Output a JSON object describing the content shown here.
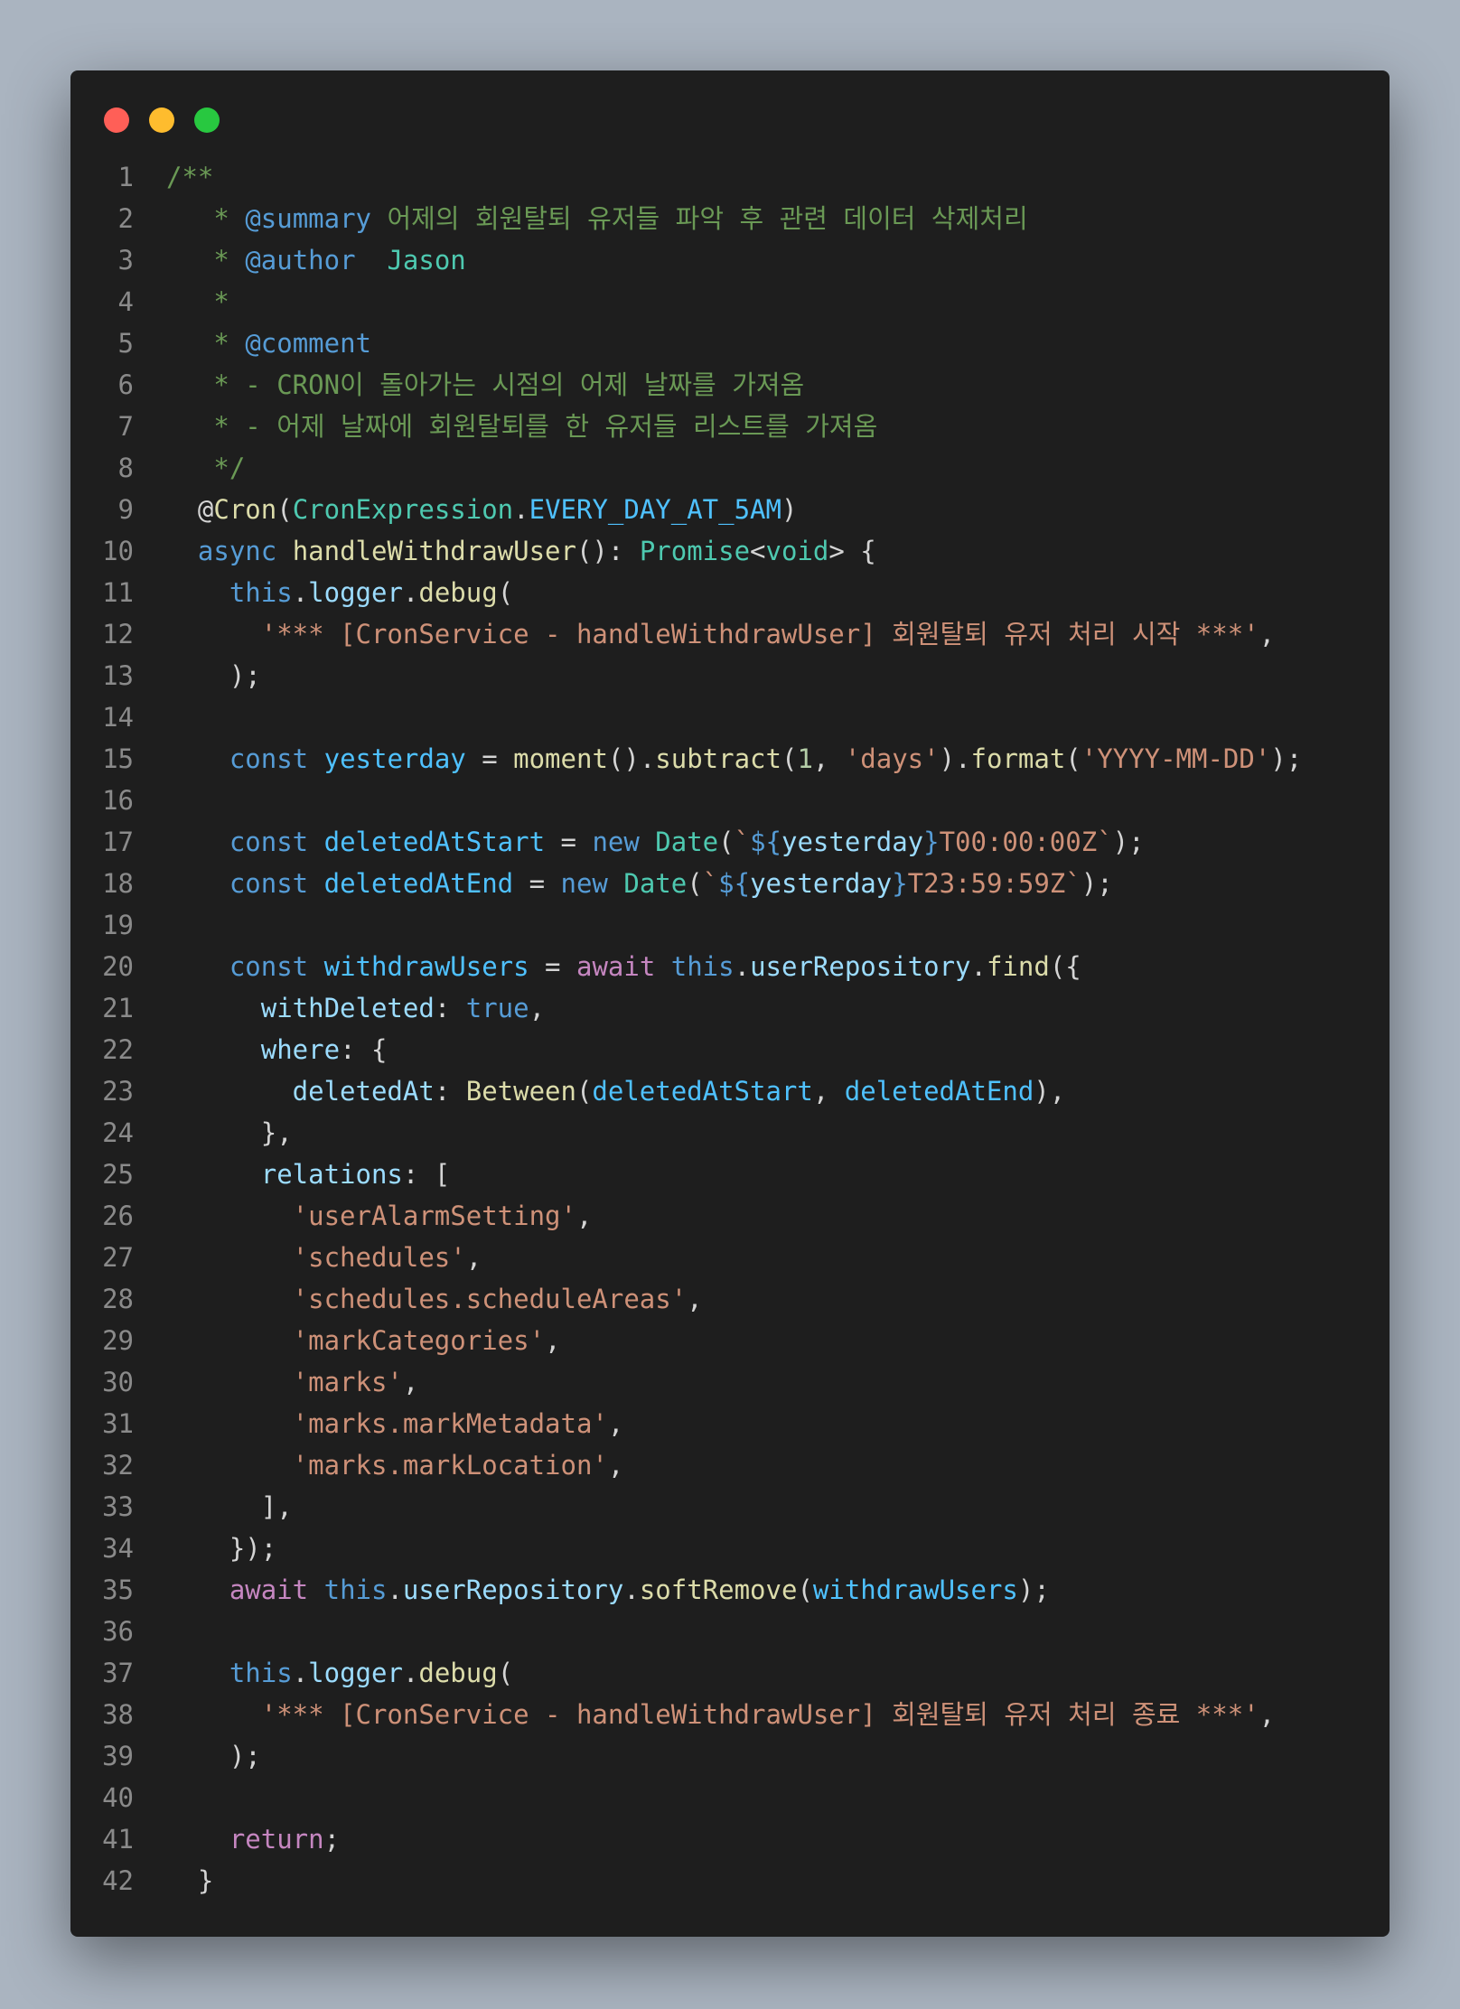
{
  "window": {
    "controls": {
      "close": "close",
      "minimize": "minimize",
      "zoom": "zoom"
    },
    "colors": {
      "close": "#ff5f57",
      "minimize": "#febc2e",
      "zoom": "#28c840",
      "background": "#1e1e1e"
    }
  },
  "code": {
    "language": "typescript",
    "lines": [
      {
        "n": "1",
        "t": [
          [
            "cm",
            "/**"
          ]
        ]
      },
      {
        "n": "2",
        "t": [
          [
            "cm",
            "   * "
          ],
          [
            "cmtag",
            "@summary"
          ],
          [
            "cm",
            " 어제의 회원탈퇴 유저들 파악 후 관련 데이터 삭제처리"
          ]
        ]
      },
      {
        "n": "3",
        "t": [
          [
            "cm",
            "   * "
          ],
          [
            "cmtag",
            "@author"
          ],
          [
            "cm",
            "  "
          ],
          [
            "ty",
            "Jason"
          ]
        ]
      },
      {
        "n": "4",
        "t": [
          [
            "cm",
            "   *"
          ]
        ]
      },
      {
        "n": "5",
        "t": [
          [
            "cm",
            "   * "
          ],
          [
            "cmtag",
            "@comment"
          ]
        ]
      },
      {
        "n": "6",
        "t": [
          [
            "cm",
            "   * - CRON이 돌아가는 시점의 어제 날짜를 가져옴"
          ]
        ]
      },
      {
        "n": "7",
        "t": [
          [
            "cm",
            "   * - 어제 날짜에 회원탈퇴를 한 유저들 리스트를 가져옴"
          ]
        ]
      },
      {
        "n": "8",
        "t": [
          [
            "cm",
            "   */"
          ]
        ]
      },
      {
        "n": "9",
        "t": [
          [
            "pn",
            "  @"
          ],
          [
            "fn",
            "Cron"
          ],
          [
            "pn",
            "("
          ],
          [
            "ty",
            "CronExpression"
          ],
          [
            "pn",
            "."
          ],
          [
            "cst",
            "EVERY_DAY_AT_5AM"
          ],
          [
            "pn",
            ")"
          ]
        ]
      },
      {
        "n": "10",
        "t": [
          [
            "kw",
            "  async "
          ],
          [
            "fn",
            "handleWithdrawUser"
          ],
          [
            "pn",
            "(): "
          ],
          [
            "ty",
            "Promise"
          ],
          [
            "pn",
            "<"
          ],
          [
            "ty",
            "void"
          ],
          [
            "pn",
            "> {"
          ]
        ]
      },
      {
        "n": "11",
        "t": [
          [
            "kw",
            "    this"
          ],
          [
            "pn",
            "."
          ],
          [
            "var",
            "logger"
          ],
          [
            "pn",
            "."
          ],
          [
            "fn",
            "debug"
          ],
          [
            "pn",
            "("
          ]
        ]
      },
      {
        "n": "12",
        "t": [
          [
            "str",
            "      '*** [CronService - handleWithdrawUser] 회원탈퇴 유저 처리 시작 ***'"
          ],
          [
            "pn",
            ","
          ]
        ]
      },
      {
        "n": "13",
        "t": [
          [
            "pn",
            "    );"
          ]
        ]
      },
      {
        "n": "14",
        "t": []
      },
      {
        "n": "15",
        "t": [
          [
            "kw",
            "    const "
          ],
          [
            "cst",
            "yesterday"
          ],
          [
            "pn",
            " = "
          ],
          [
            "fn",
            "moment"
          ],
          [
            "pn",
            "()."
          ],
          [
            "fn",
            "subtract"
          ],
          [
            "pn",
            "("
          ],
          [
            "num",
            "1"
          ],
          [
            "pn",
            ", "
          ],
          [
            "str",
            "'days'"
          ],
          [
            "pn",
            ")."
          ],
          [
            "fn",
            "format"
          ],
          [
            "pn",
            "("
          ],
          [
            "str",
            "'YYYY-MM-DD'"
          ],
          [
            "pn",
            ");"
          ]
        ]
      },
      {
        "n": "16",
        "t": []
      },
      {
        "n": "17",
        "t": [
          [
            "kw",
            "    const "
          ],
          [
            "cst",
            "deletedAtStart"
          ],
          [
            "pn",
            " = "
          ],
          [
            "kw",
            "new "
          ],
          [
            "ty",
            "Date"
          ],
          [
            "pn",
            "("
          ],
          [
            "str",
            "`"
          ],
          [
            "kw",
            "${"
          ],
          [
            "var",
            "yesterday"
          ],
          [
            "kw",
            "}"
          ],
          [
            "str",
            "T00:00:00Z`"
          ],
          [
            "pn",
            ");"
          ]
        ]
      },
      {
        "n": "18",
        "t": [
          [
            "kw",
            "    const "
          ],
          [
            "cst",
            "deletedAtEnd"
          ],
          [
            "pn",
            " = "
          ],
          [
            "kw",
            "new "
          ],
          [
            "ty",
            "Date"
          ],
          [
            "pn",
            "("
          ],
          [
            "str",
            "`"
          ],
          [
            "kw",
            "${"
          ],
          [
            "var",
            "yesterday"
          ],
          [
            "kw",
            "}"
          ],
          [
            "str",
            "T23:59:59Z`"
          ],
          [
            "pn",
            ");"
          ]
        ]
      },
      {
        "n": "19",
        "t": []
      },
      {
        "n": "20",
        "t": [
          [
            "kw",
            "    const "
          ],
          [
            "cst",
            "withdrawUsers"
          ],
          [
            "pn",
            " = "
          ],
          [
            "ctl",
            "await "
          ],
          [
            "kw",
            "this"
          ],
          [
            "pn",
            "."
          ],
          [
            "var",
            "userRepository"
          ],
          [
            "pn",
            "."
          ],
          [
            "fn",
            "find"
          ],
          [
            "pn",
            "({"
          ]
        ]
      },
      {
        "n": "21",
        "t": [
          [
            "var",
            "      withDeleted"
          ],
          [
            "pn",
            ": "
          ],
          [
            "kw",
            "true"
          ],
          [
            "pn",
            ","
          ]
        ]
      },
      {
        "n": "22",
        "t": [
          [
            "var",
            "      where"
          ],
          [
            "pn",
            ": {"
          ]
        ]
      },
      {
        "n": "23",
        "t": [
          [
            "var",
            "        deletedAt"
          ],
          [
            "pn",
            ": "
          ],
          [
            "fn",
            "Between"
          ],
          [
            "pn",
            "("
          ],
          [
            "cst",
            "deletedAtStart"
          ],
          [
            "pn",
            ", "
          ],
          [
            "cst",
            "deletedAtEnd"
          ],
          [
            "pn",
            "),"
          ]
        ]
      },
      {
        "n": "24",
        "t": [
          [
            "pn",
            "      },"
          ]
        ]
      },
      {
        "n": "25",
        "t": [
          [
            "var",
            "      relations"
          ],
          [
            "pn",
            ": ["
          ]
        ]
      },
      {
        "n": "26",
        "t": [
          [
            "str",
            "        'userAlarmSetting'"
          ],
          [
            "pn",
            ","
          ]
        ]
      },
      {
        "n": "27",
        "t": [
          [
            "str",
            "        'schedules'"
          ],
          [
            "pn",
            ","
          ]
        ]
      },
      {
        "n": "28",
        "t": [
          [
            "str",
            "        'schedules.scheduleAreas'"
          ],
          [
            "pn",
            ","
          ]
        ]
      },
      {
        "n": "29",
        "t": [
          [
            "str",
            "        'markCategories'"
          ],
          [
            "pn",
            ","
          ]
        ]
      },
      {
        "n": "30",
        "t": [
          [
            "str",
            "        'marks'"
          ],
          [
            "pn",
            ","
          ]
        ]
      },
      {
        "n": "31",
        "t": [
          [
            "str",
            "        'marks.markMetadata'"
          ],
          [
            "pn",
            ","
          ]
        ]
      },
      {
        "n": "32",
        "t": [
          [
            "str",
            "        'marks.markLocation'"
          ],
          [
            "pn",
            ","
          ]
        ]
      },
      {
        "n": "33",
        "t": [
          [
            "pn",
            "      ],"
          ]
        ]
      },
      {
        "n": "34",
        "t": [
          [
            "pn",
            "    });"
          ]
        ]
      },
      {
        "n": "35",
        "t": [
          [
            "ctl",
            "    await "
          ],
          [
            "kw",
            "this"
          ],
          [
            "pn",
            "."
          ],
          [
            "var",
            "userRepository"
          ],
          [
            "pn",
            "."
          ],
          [
            "fn",
            "softRemove"
          ],
          [
            "pn",
            "("
          ],
          [
            "cst",
            "withdrawUsers"
          ],
          [
            "pn",
            ");"
          ]
        ]
      },
      {
        "n": "36",
        "t": []
      },
      {
        "n": "37",
        "t": [
          [
            "kw",
            "    this"
          ],
          [
            "pn",
            "."
          ],
          [
            "var",
            "logger"
          ],
          [
            "pn",
            "."
          ],
          [
            "fn",
            "debug"
          ],
          [
            "pn",
            "("
          ]
        ]
      },
      {
        "n": "38",
        "t": [
          [
            "str",
            "      '*** [CronService - handleWithdrawUser] 회원탈퇴 유저 처리 종료 ***'"
          ],
          [
            "pn",
            ","
          ]
        ]
      },
      {
        "n": "39",
        "t": [
          [
            "pn",
            "    );"
          ]
        ]
      },
      {
        "n": "40",
        "t": []
      },
      {
        "n": "41",
        "t": [
          [
            "ctl",
            "    return"
          ],
          [
            "pn",
            ";"
          ]
        ]
      },
      {
        "n": "42",
        "t": [
          [
            "pn",
            "  }"
          ]
        ]
      }
    ]
  }
}
